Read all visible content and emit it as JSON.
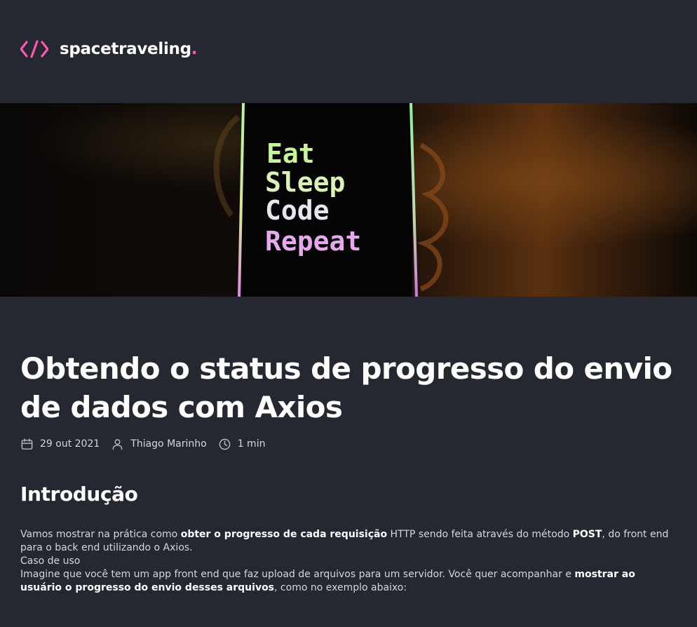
{
  "app": {
    "brand": "spacetraveling",
    "brand_dot": ".",
    "accent_color": "#FF57B2",
    "background_color": "#252831"
  },
  "header": {
    "logo_icon": "code-brackets-icon"
  },
  "banner": {
    "image_description_text_lines": [
      "Eat",
      "Sleep",
      "Code",
      "Repeat"
    ]
  },
  "post": {
    "title": "Obtendo o status de progresso do envio de dados com Axios",
    "meta": {
      "date": "29 out 2021",
      "author": "Thiago Marinho",
      "reading_time": "1 min",
      "date_icon": "calendar-icon",
      "author_icon": "user-icon",
      "time_icon": "clock-icon"
    },
    "section_heading": "Introdução",
    "paragraph1": {
      "p1": "Vamos mostrar na prática como ",
      "b1": "obter o progresso de cada requisição",
      "p2": " HTTP sendo feita através do método ",
      "b2": "POST",
      "p3": ", do front end para o back end utilizando o Axios."
    },
    "paragraph2": "Caso de uso",
    "paragraph3": {
      "p1": "Imagine que você tem um app front end que faz upload de arquivos para um servidor. Você quer acompanhar e ",
      "b1": "mostrar ao usuário o progresso do envio desses arquivos",
      "p2": ", como no exemplo abaixo:"
    }
  }
}
